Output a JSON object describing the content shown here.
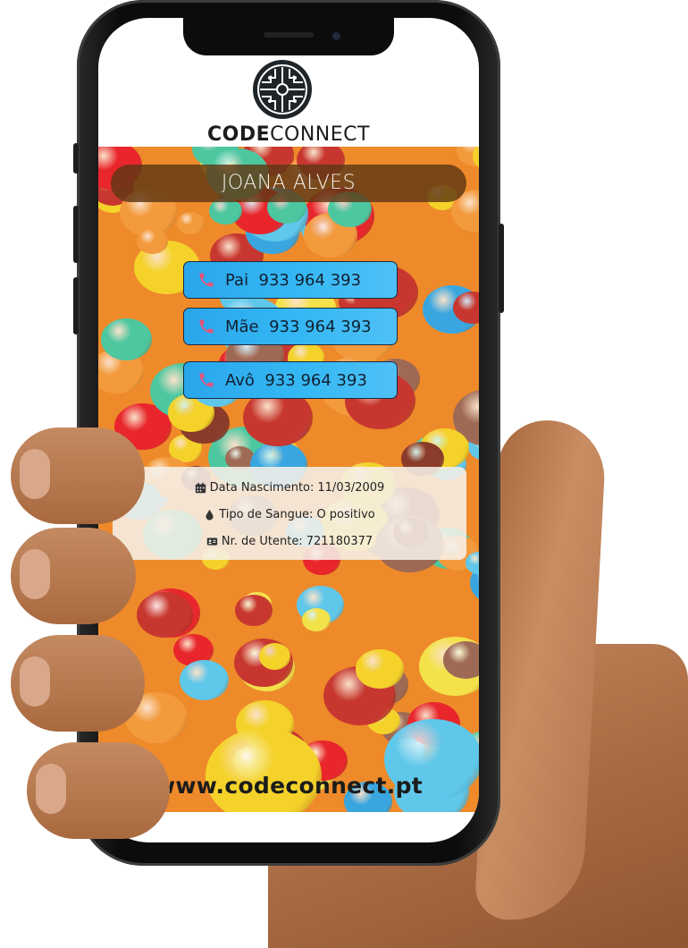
{
  "brand": {
    "bold": "CODE",
    "light": "CONNECT",
    "logo_icon": "circuit-cross-logo"
  },
  "profile": {
    "name": "JOANA ALVES"
  },
  "contacts": [
    {
      "relation": "Pai",
      "phone": "933 964 393",
      "icon": "phone-icon"
    },
    {
      "relation": "Mãe",
      "phone": "933 964 393",
      "icon": "phone-icon"
    },
    {
      "relation": "Avô",
      "phone": "933 964 393",
      "icon": "phone-icon"
    }
  ],
  "info": {
    "birth": {
      "label": "Data Nascimento:",
      "value": "11/03/2009",
      "icon": "calendar-icon"
    },
    "blood": {
      "label": "Tipo de Sangue:",
      "value": "O positivo",
      "icon": "drop-icon"
    },
    "health": {
      "label": "Nr. de Utente:",
      "value": "721180377",
      "icon": "id-card-icon"
    }
  },
  "website": "www.codeconnect.pt",
  "colors": {
    "background": "#ee8a2a",
    "button": "#34b8f4",
    "name_bar": "#5f3714",
    "phone_icon": "#e2557a"
  }
}
